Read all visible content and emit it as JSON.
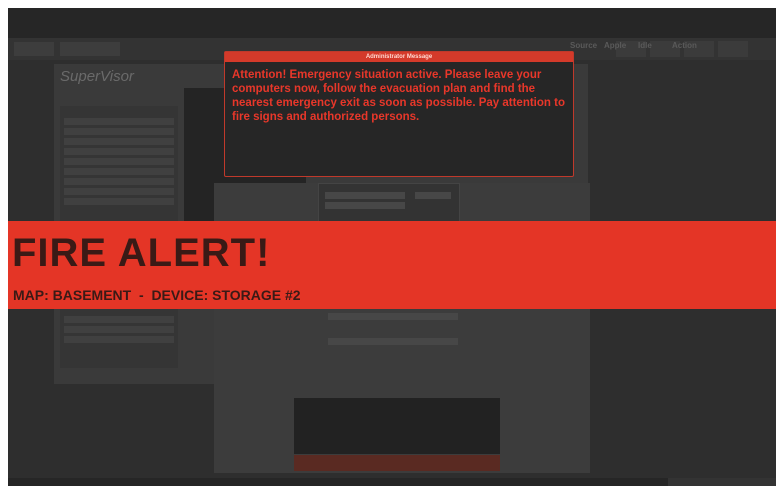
{
  "app": {
    "title": "SuperVisor"
  },
  "toolbar": {
    "labels": [
      "Source",
      "Apple",
      "Idle",
      "Action"
    ]
  },
  "dialog": {
    "title": "Administrator Message",
    "message": "Attention! Emergency situation active. Please leave your computers now, follow the evacuation plan and find the nearest emergency exit as soon as possible. Pay attention to fire signs and authorized persons."
  },
  "alert": {
    "title": "FIRE ALERT!",
    "subtitle": "MAP: BASEMENT  -  DEVICE: STORAGE #2"
  },
  "colors": {
    "alert_red": "#e43526",
    "dialog_border": "#c0392b",
    "alert_text": "#3a1a16"
  }
}
